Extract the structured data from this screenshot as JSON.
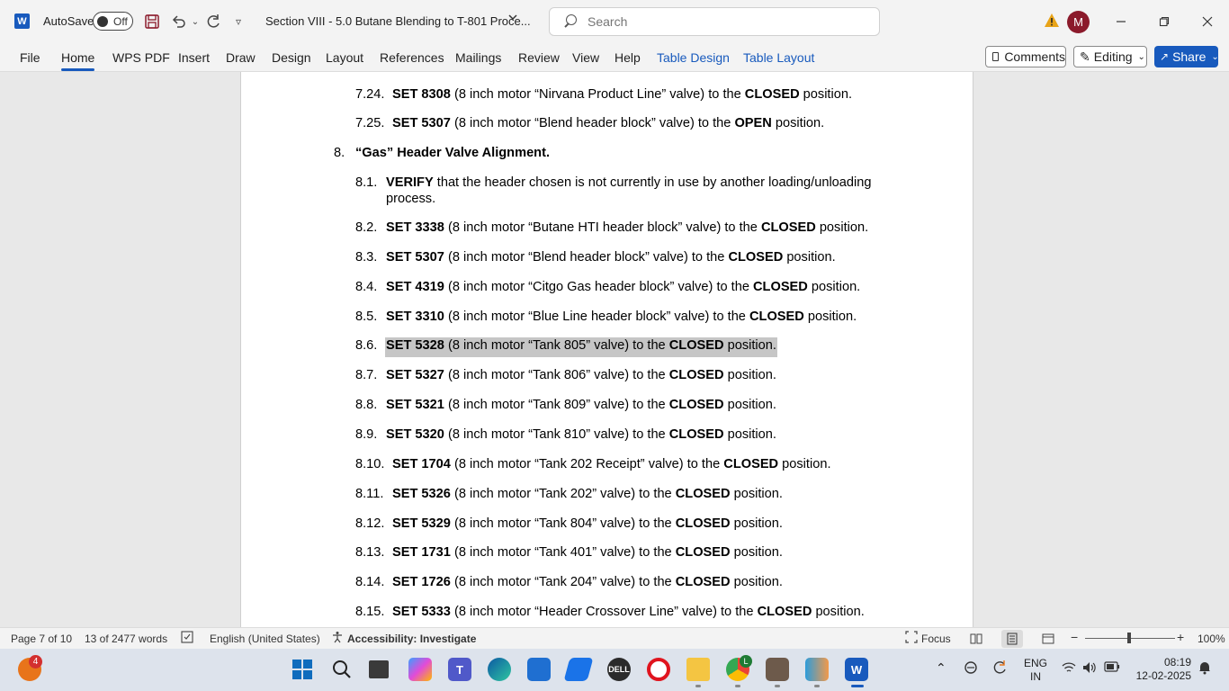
{
  "titlebar": {
    "app_icon": "word-icon",
    "app_letter": "W",
    "autosave_label": "AutoSave",
    "autosave_state": "Off",
    "doc_title": "Section VIII - 5.0 Butane Blending to T-801 Proce...",
    "search_placeholder": "Search",
    "avatar_initial": "M",
    "accent": "#185abd"
  },
  "ribbon": {
    "tabs": [
      "File",
      "Home",
      "WPS PDF",
      "Insert",
      "Draw",
      "Design",
      "Layout",
      "References",
      "Mailings",
      "Review",
      "View",
      "Help",
      "Table Design",
      "Table Layout"
    ],
    "active_tab": "Home",
    "comments": "Comments",
    "editing": "Editing",
    "share": "Share"
  },
  "document": {
    "lines": [
      {
        "num": "7.24.",
        "cmd": "SET 8308",
        "mid": " (8 inch motor “Nirvana Product Line” valve) to the ",
        "state": "CLOSED",
        "end": " position."
      },
      {
        "num": "7.25.",
        "cmd": "SET 5307",
        "mid": " (8 inch motor “Blend header block” valve) to the ",
        "state": "OPEN",
        "end": " position."
      },
      {
        "num": "8.",
        "heading": "“Gas” Header Valve Alignment."
      },
      {
        "num": "8.1.",
        "cmd": "VERIFY",
        "mid": " that the header chosen is not currently in use by another loading/unloading",
        "line2": "process."
      },
      {
        "num": "8.2.",
        "cmd": "SET 3338",
        "mid": " (8 inch motor “Butane HTI header block” valve) to the ",
        "state": "CLOSED",
        "end": " position."
      },
      {
        "num": "8.3.",
        "cmd": "SET 5307",
        "mid": " (8 inch motor “Blend header block” valve) to the ",
        "state": "CLOSED",
        "end": " position."
      },
      {
        "num": "8.4.",
        "cmd": "SET 4319",
        "mid": " (8 inch motor “Citgo Gas header block” valve) to the ",
        "state": "CLOSED",
        "end": " position."
      },
      {
        "num": "8.5.",
        "cmd": "SET 3310",
        "mid": " (8 inch motor “Blue Line header block” valve) to the ",
        "state": "CLOSED",
        "end": " position."
      },
      {
        "num": "8.6.",
        "cmd": "SET 5328",
        "mid": " (8 inch motor “Tank 805” valve) to the ",
        "state": "CLOSED",
        "end": " position."
      },
      {
        "num": "8.7.",
        "cmd": "SET 5327",
        "mid": " (8 inch motor “Tank 806” valve) to the ",
        "state": "CLOSED",
        "end": " position."
      },
      {
        "num": "8.8.",
        "cmd": "SET 5321",
        "mid": " (8 inch motor “Tank 809” valve) to the ",
        "state": "CLOSED",
        "end": " position."
      },
      {
        "num": "8.9.",
        "cmd": "SET 5320",
        "mid": " (8 inch motor “Tank 810” valve) to the ",
        "state": "CLOSED",
        "end": " position."
      },
      {
        "num": "8.10.",
        "cmd": "SET 1704",
        "mid": " (8 inch motor “Tank 202 Receipt” valve) to the ",
        "state": "CLOSED",
        "end": " position."
      },
      {
        "num": "8.11.",
        "cmd": "SET 5326",
        "mid": " (8 inch motor “Tank 202” valve) to the ",
        "state": "CLOSED",
        "end": " position."
      },
      {
        "num": "8.12.",
        "cmd": "SET 5329",
        "mid": " (8 inch motor “Tank 804” valve) to the ",
        "state": "CLOSED",
        "end": " position."
      },
      {
        "num": "8.13.",
        "cmd": "SET 1731",
        "mid": " (8 inch motor “Tank 401” valve) to the ",
        "state": "CLOSED",
        "end": " position."
      },
      {
        "num": "8.14.",
        "cmd": "SET 1726",
        "mid": " (8 inch motor “Tank 204” valve) to the ",
        "state": "CLOSED",
        "end": " position."
      },
      {
        "num": "8.15.",
        "cmd": "SET 5333",
        "mid": " (8 inch motor “Header Crossover Line” valve) to the ",
        "state": "CLOSED",
        "end": " position."
      }
    ]
  },
  "statusbar": {
    "page": "Page 7 of 10",
    "words": "13 of 2477 words",
    "language": "English (United States)",
    "accessibility": "Accessibility: Investigate",
    "focus": "Focus",
    "zoom": "100%"
  },
  "taskbar": {
    "badge_count": "4",
    "profile_letter": "L",
    "lang_top": "ENG",
    "lang_bottom": "IN",
    "time": "08:19",
    "date": "12-02-2025"
  }
}
